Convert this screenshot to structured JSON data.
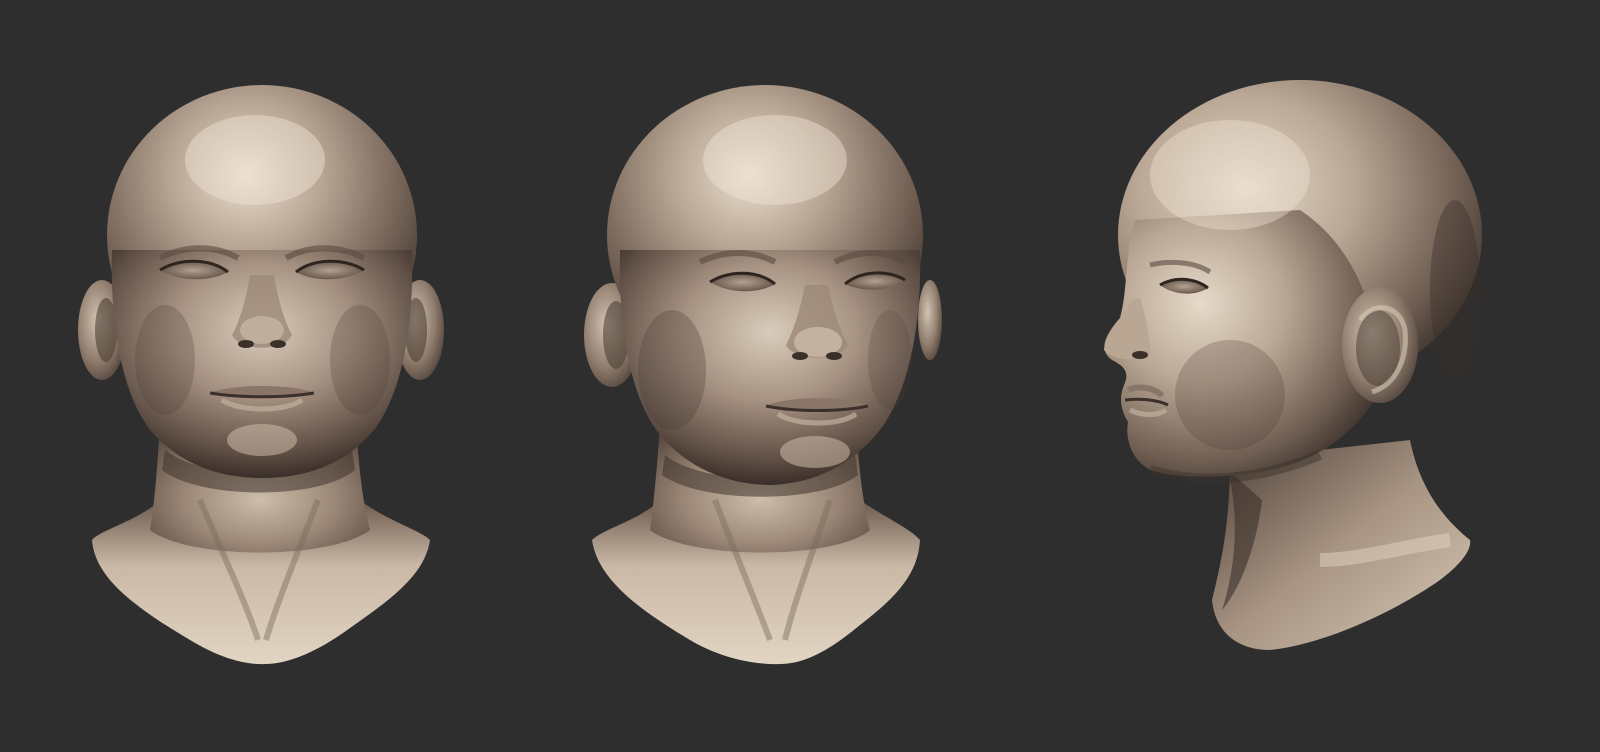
{
  "scene": {
    "background_color": "#2e2e2e",
    "material_colors": {
      "highlight": "#e9ddcd",
      "mid": "#a69282",
      "shadow": "#4a3d35",
      "deep_shadow": "#2a221e"
    },
    "views": [
      {
        "view": "front"
      },
      {
        "view": "three-quarter"
      },
      {
        "view": "profile-left"
      }
    ]
  }
}
